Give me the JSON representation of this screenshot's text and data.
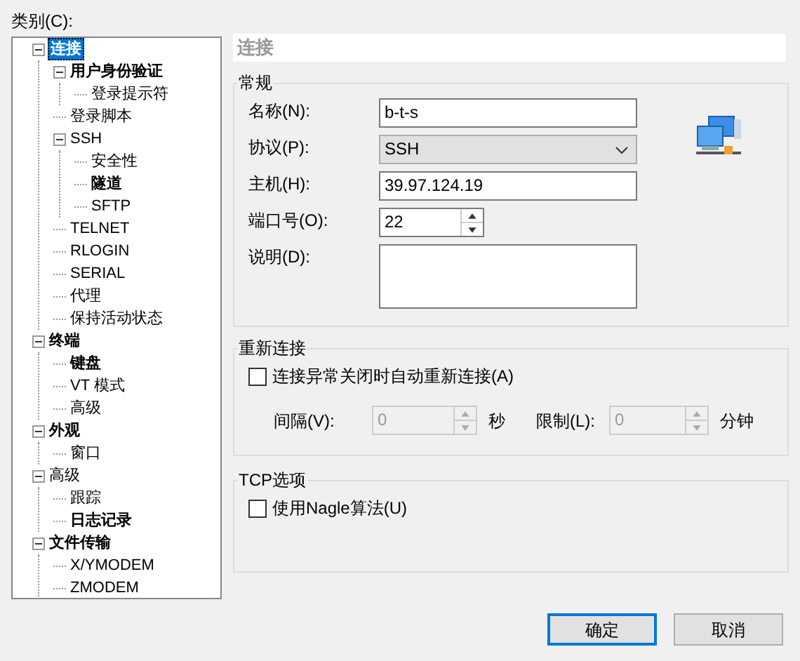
{
  "category_label": "类别(C):",
  "tree": [
    {
      "label": "连接",
      "bold": true,
      "selected": true,
      "expanded": true,
      "children": [
        {
          "label": "用户身份验证",
          "bold": true,
          "selected": false,
          "expanded": true,
          "children": [
            {
              "label": "登录提示符",
              "bold": false,
              "selected": false
            }
          ]
        },
        {
          "label": "登录脚本",
          "bold": false,
          "selected": false
        },
        {
          "label": "SSH",
          "bold": false,
          "selected": false,
          "expanded": true,
          "children": [
            {
              "label": "安全性",
              "bold": false,
              "selected": false
            },
            {
              "label": "隧道",
              "bold": true,
              "selected": false
            },
            {
              "label": "SFTP",
              "bold": false,
              "selected": false
            }
          ]
        },
        {
          "label": "TELNET",
          "bold": false,
          "selected": false
        },
        {
          "label": "RLOGIN",
          "bold": false,
          "selected": false
        },
        {
          "label": "SERIAL",
          "bold": false,
          "selected": false
        },
        {
          "label": "代理",
          "bold": false,
          "selected": false
        },
        {
          "label": "保持活动状态",
          "bold": false,
          "selected": false
        }
      ]
    },
    {
      "label": "终端",
      "bold": true,
      "selected": false,
      "expanded": true,
      "children": [
        {
          "label": "键盘",
          "bold": true,
          "selected": false
        },
        {
          "label": "VT 模式",
          "bold": false,
          "selected": false
        },
        {
          "label": "高级",
          "bold": false,
          "selected": false
        }
      ]
    },
    {
      "label": "外观",
      "bold": true,
      "selected": false,
      "expanded": true,
      "children": [
        {
          "label": "窗口",
          "bold": false,
          "selected": false
        }
      ]
    },
    {
      "label": "高级",
      "bold": false,
      "selected": false,
      "expanded": true,
      "children": [
        {
          "label": "跟踪",
          "bold": false,
          "selected": false
        },
        {
          "label": "日志记录",
          "bold": true,
          "selected": false
        }
      ]
    },
    {
      "label": "文件传输",
      "bold": true,
      "selected": false,
      "expanded": true,
      "children": [
        {
          "label": "X/YMODEM",
          "bold": false,
          "selected": false
        },
        {
          "label": "ZMODEM",
          "bold": false,
          "selected": false
        }
      ]
    }
  ],
  "panel_title": "连接",
  "general": {
    "title": "常规",
    "fields": [
      {
        "kind": "text",
        "label": "名称(N):",
        "value": "b-t-s"
      },
      {
        "kind": "select",
        "label": "协议(P):",
        "value": "SSH"
      },
      {
        "kind": "text",
        "label": "主机(H):",
        "value": "39.97.124.19"
      },
      {
        "kind": "spinner",
        "label": "端口号(O):",
        "value": "22"
      },
      {
        "kind": "textarea",
        "label": "说明(D):"
      }
    ]
  },
  "reconnect": {
    "title": "重新连接",
    "checkbox": {
      "label": "连接异常关闭时自动重新连接(A)",
      "checked": false
    },
    "interval": {
      "label": "间隔(V):",
      "value": "0",
      "unit": "秒",
      "disabled": true
    },
    "limit": {
      "label": "限制(L):",
      "value": "0",
      "unit": "分钟",
      "disabled": true
    }
  },
  "tcp": {
    "title": "TCP选项",
    "checkbox": {
      "label": "使用Nagle算法(U)",
      "checked": false
    }
  },
  "buttons": [
    {
      "label": "确定",
      "default": true
    },
    {
      "label": "取消",
      "default": false
    }
  ]
}
